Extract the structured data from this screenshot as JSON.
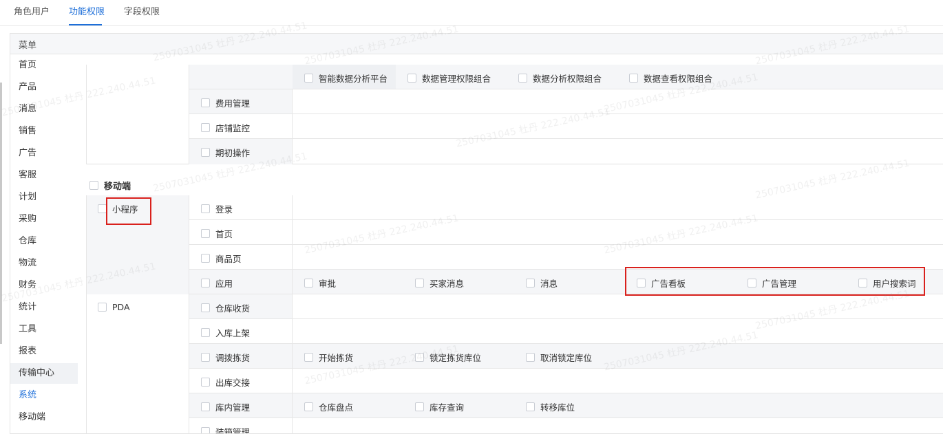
{
  "tabs": [
    {
      "label": "角色用户",
      "active": false
    },
    {
      "label": "功能权限",
      "active": true
    },
    {
      "label": "字段权限",
      "active": false
    }
  ],
  "panel": {
    "header": "菜单"
  },
  "menu": [
    "首页",
    "产品",
    "消息",
    "销售",
    "广告",
    "客服",
    "计划",
    "采购",
    "仓库",
    "物流",
    "财务",
    "统计",
    "工具",
    "报表",
    "传输中心",
    "系统",
    "移动端"
  ],
  "menu_active": "系统",
  "top_options": [
    "智能数据分析平台",
    "数据管理权限组合",
    "数据分析权限组合",
    "数据查看权限组合"
  ],
  "finance_rows": [
    "费用管理",
    "店铺监控",
    "期初操作"
  ],
  "mobile": {
    "label": "移动端",
    "miniprogram": {
      "label": "小程序",
      "rows": [
        "登录",
        "首页",
        "商品页",
        "应用"
      ],
      "app_options": [
        "审批",
        "买家消息",
        "消息",
        "广告看板",
        "广告管理",
        "用户搜索词"
      ]
    },
    "pda": {
      "label": "PDA",
      "rows": [
        "仓库收货",
        "入库上架",
        "调拨拣货",
        "出库交接",
        "库内管理",
        "装箱管理"
      ],
      "pick_options": [
        "开始拣货",
        "锁定拣货库位",
        "取消锁定库位"
      ],
      "storage_options": [
        "仓库盘点",
        "库存查询",
        "转移库位"
      ]
    }
  },
  "watermark": "2507031045 杜丹 222.240.44.51",
  "colors": {
    "accent": "#1e6fd9",
    "highlight_box": "#d9201c",
    "header_bg": "#f6f7f9"
  }
}
